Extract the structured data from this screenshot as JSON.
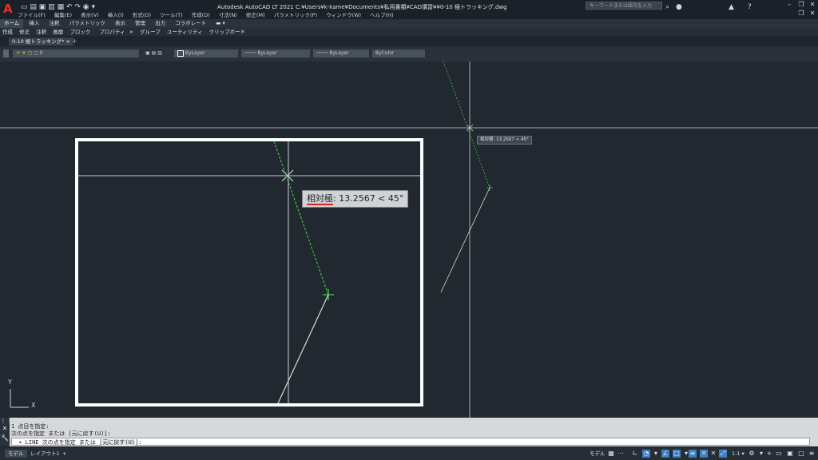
{
  "titlebar": {
    "app_logo": "A",
    "title": "Autodesk AutoCAD LT 2021   C:¥Users¥k-kame¥Documents¥私用書類¥CAD講習¥¥0-10 極トラッキング.dwg",
    "search_placeholder": "キーワードまたは語句を入力"
  },
  "menu": [
    "ファイル(F)",
    "編集(E)",
    "表示(V)",
    "挿入(I)",
    "形式(O)",
    "ツール(T)",
    "作成(D)",
    "寸法(N)",
    "修正(M)",
    "パラメトリック(P)",
    "ウィンドウ(W)",
    "ヘルプ(H)"
  ],
  "ribbon_tabs": [
    "ホーム",
    "挿入",
    "注釈",
    "パラメトリック",
    "表示",
    "管理",
    "出力",
    "コラボレート"
  ],
  "ribbon_panels": [
    "作成",
    "修正",
    "注釈",
    "画層",
    "ブロック",
    "プロパティ",
    "グループ",
    "ユーティリティ",
    "クリップボード"
  ],
  "doc_tab": "0-10 極トラッキング*",
  "properties": {
    "layer_value": "0",
    "color": "ByLayer",
    "linetype": "ByLayer",
    "lineweight": "ByLayer",
    "plotstyle": "ByColor"
  },
  "tooltip_small": "相対極: 13.2567 < 45°",
  "zoom_tooltip": {
    "label": "相対極",
    "value": ": 13.2567 < 45°"
  },
  "ucs": {
    "y": "Y",
    "x": "X"
  },
  "command": {
    "history_1": "1 点目を指定:",
    "history_2": "次の点を指定 または [元に戻す(U)]:",
    "prompt_prefix": " ▾ LINE 次の点を指定 または [",
    "prompt_option": "元に戻す(U)",
    "prompt_suffix": "]:"
  },
  "status": {
    "model_tab": "モデル",
    "layout_tab": "レイアウト1",
    "model_label": "モデル",
    "scale": "1:1"
  },
  "colors": {
    "background": "#212830",
    "accent": "#3f7fc2",
    "track": "#3fc43f",
    "highlight": "#e0201a"
  }
}
